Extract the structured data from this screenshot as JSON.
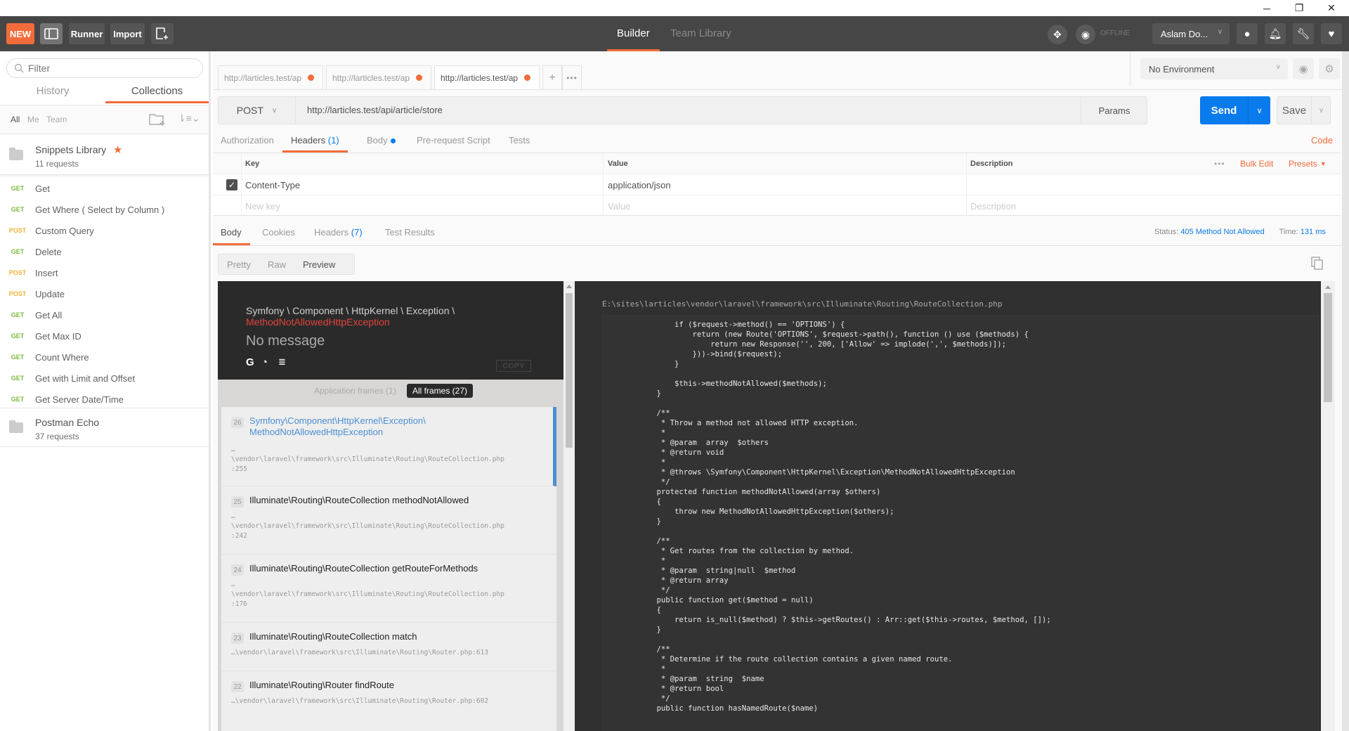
{
  "window": {
    "controls": [
      {
        "name": "minimize",
        "glyph": "─"
      },
      {
        "name": "restore",
        "glyph": "❐"
      },
      {
        "name": "close",
        "glyph": "✕"
      }
    ]
  },
  "header": {
    "new_label": "NEW",
    "runner_label": "Runner",
    "import_label": "Import",
    "center_tabs": [
      {
        "label": "Builder",
        "active": true
      },
      {
        "label": "Team Library",
        "active": false
      }
    ],
    "sync_status": "OFFLINE",
    "user_label": "Aslam Do...",
    "accent_color": "#f26b3a"
  },
  "sidebar": {
    "filter_placeholder": "Filter",
    "tabs": [
      {
        "label": "History",
        "active": false
      },
      {
        "label": "Collections",
        "active": true
      }
    ],
    "owner_filters": [
      "All",
      "Me",
      "Team"
    ],
    "collections": [
      {
        "name": "Snippets Library",
        "count": "11 requests",
        "starred": true,
        "requests": [
          {
            "method": "GET",
            "name": "Get"
          },
          {
            "method": "GET",
            "name": "Get Where ( Select by Column )"
          },
          {
            "method": "POST",
            "name": "Custom Query"
          },
          {
            "method": "GET",
            "name": "Delete"
          },
          {
            "method": "POST",
            "name": "Insert"
          },
          {
            "method": "POST",
            "name": "Update"
          },
          {
            "method": "GET",
            "name": "Get All"
          },
          {
            "method": "GET",
            "name": "Get Max ID"
          },
          {
            "method": "GET",
            "name": "Count Where"
          },
          {
            "method": "GET",
            "name": "Get with Limit and Offset"
          },
          {
            "method": "GET",
            "name": "Get Server Date/Time"
          }
        ]
      },
      {
        "name": "Postman Echo",
        "count": "37 requests",
        "starred": false
      }
    ]
  },
  "request_tabs": [
    {
      "label": "http://larticles.test/ap",
      "active": false
    },
    {
      "label": "http://larticles.test/ap",
      "active": false
    },
    {
      "label": "http://larticles.test/ap",
      "active": true
    }
  ],
  "environment": {
    "selected": "No Environment"
  },
  "request": {
    "method": "POST",
    "url": "http://larticles.test/api/article/store",
    "params_label": "Params",
    "send_label": "Send",
    "save_label": "Save",
    "tabs": [
      {
        "label": "Authorization",
        "count": ""
      },
      {
        "label": "Headers",
        "count": "(1)",
        "active": true
      },
      {
        "label": "Body",
        "dot": true
      },
      {
        "label": "Pre-request Script"
      },
      {
        "label": "Tests"
      }
    ],
    "code_label": "Code"
  },
  "headers_table": {
    "columns": [
      "Key",
      "Value",
      "Description"
    ],
    "bulk_edit_label": "Bulk Edit",
    "presets_label": "Presets",
    "rows": [
      {
        "checked": true,
        "key": "Content-Type",
        "value": "application/json",
        "description": ""
      }
    ],
    "placeholders": {
      "key": "New key",
      "value": "Value",
      "description": "Description"
    }
  },
  "response": {
    "tabs": [
      {
        "label": "Body",
        "active": true
      },
      {
        "label": "Cookies"
      },
      {
        "label": "Headers",
        "count": "(7)"
      },
      {
        "label": "Test Results"
      }
    ],
    "status_label": "Status:",
    "status_value": "405 Method Not Allowed",
    "time_label": "Time:",
    "time_value": "131 ms",
    "view_modes": [
      {
        "label": "Pretty"
      },
      {
        "label": "Raw"
      },
      {
        "label": "Preview",
        "active": true
      }
    ]
  },
  "error_page": {
    "namespace": "Symfony \\ Component \\ HttpKernel \\ Exception \\",
    "exception": "MethodNotAllowedHttpException",
    "message": "No message",
    "copy_label": "COPY",
    "frame_tabs": {
      "application": "Application frames (1)",
      "all": "All frames (27)"
    },
    "frames": [
      {
        "num": "26",
        "cls1": "Symfony\\Component\\HttpKernel\\Exception\\",
        "cls2": "MethodNotAllowedHttpException",
        "path1": "…",
        "path2": "\\vendor\\laravel\\framework\\src\\Illuminate\\Routing\\RouteCollection.php",
        "path3": ":255",
        "active": true
      },
      {
        "num": "25",
        "cls1": "Illuminate\\Routing\\RouteCollection methodNotAllowed",
        "path1": "…",
        "path2": "\\vendor\\laravel\\framework\\src\\Illuminate\\Routing\\RouteCollection.php",
        "path3": ":242"
      },
      {
        "num": "24",
        "cls1": "Illuminate\\Routing\\RouteCollection getRouteForMethods",
        "path1": "…",
        "path2": "\\vendor\\laravel\\framework\\src\\Illuminate\\Routing\\RouteCollection.php",
        "path3": ":176"
      },
      {
        "num": "23",
        "cls1": "Illuminate\\Routing\\RouteCollection match",
        "path1": "…\\vendor\\laravel\\framework\\src\\Illuminate\\Routing\\Router.php:613"
      },
      {
        "num": "22",
        "cls1": "Illuminate\\Routing\\Router findRoute",
        "path1": "…\\vendor\\laravel\\framework\\src\\Illuminate\\Routing\\Router.php:602"
      }
    ],
    "file_path": "E:\\sites\\larticles\\vendor\\laravel\\framework\\src\\Illuminate\\Routing\\RouteCollection.php",
    "code": "                if ($request->method() == 'OPTIONS') {\n                    return (new Route('OPTIONS', $request->path(), function () use ($methods) {\n                        return new Response('', 200, ['Allow' => implode(',', $methods)]);\n                    }))->bind($request);\n                }\n\n                $this->methodNotAllowed($methods);\n            }\n\n            /**\n             * Throw a method not allowed HTTP exception.\n             *\n             * @param  array  $others\n             * @return void\n             *\n             * @throws \\Symfony\\Component\\HttpKernel\\Exception\\MethodNotAllowedHttpException\n             */\n            protected function methodNotAllowed(array $others)\n            {\n                throw new MethodNotAllowedHttpException($others);\n            }\n\n            /**\n             * Get routes from the collection by method.\n             *\n             * @param  string|null  $method\n             * @return array\n             */\n            public function get($method = null)\n            {\n                return is_null($method) ? $this->getRoutes() : Arr::get($this->routes, $method, []);\n            }\n\n            /**\n             * Determine if the route collection contains a given named route.\n             *\n             * @param  string  $name\n             * @return bool\n             */\n            public function hasNamedRoute($name)"
  }
}
